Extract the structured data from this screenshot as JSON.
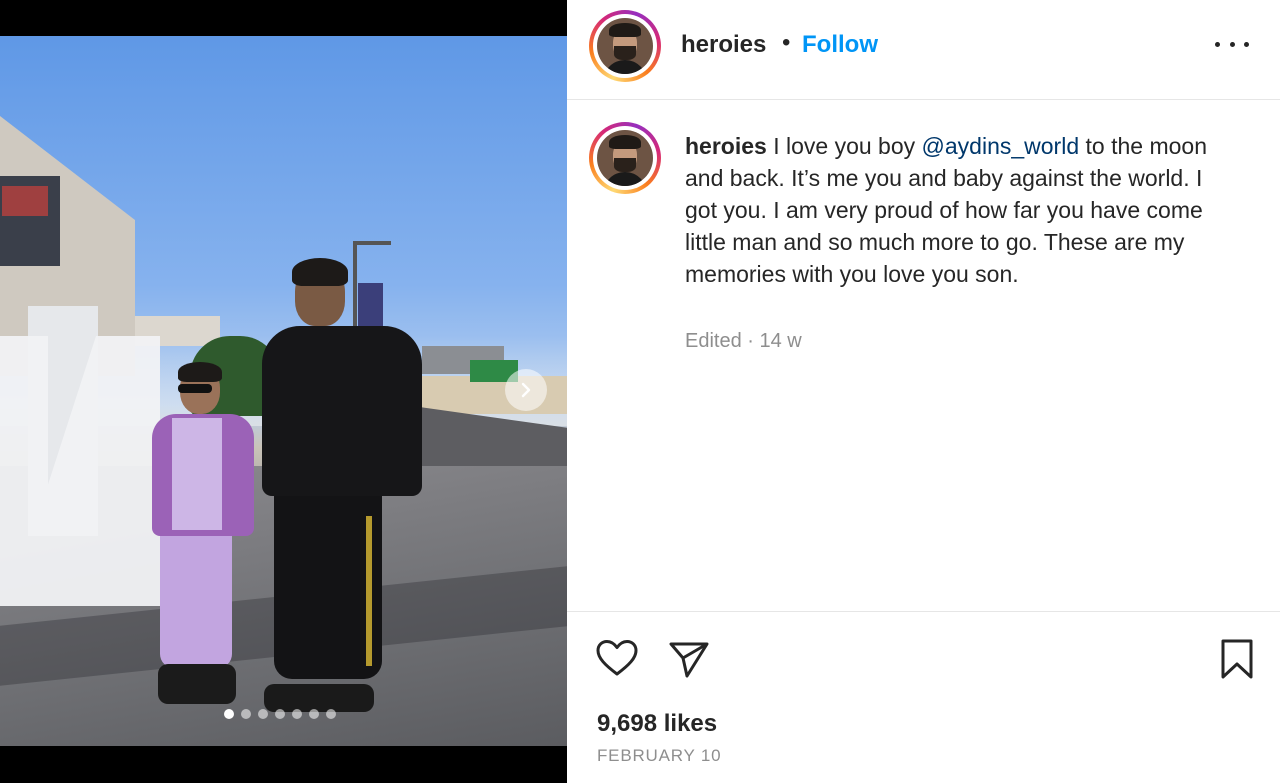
{
  "post": {
    "media": {
      "slides_total": 7,
      "active_slide": 1,
      "next_icon": "chevron-right-icon"
    },
    "header": {
      "username": "heroies",
      "separator": "•",
      "follow_label": "Follow",
      "more_icon": "more-horizontal-icon"
    },
    "caption": {
      "username": "heroies",
      "text_before": " I love you boy ",
      "mention": "@aydins_world",
      "text_after": " to the moon and back. It’s me you and baby against the world. I got you. I am very proud of how far you have come little man and so much more to go. These are my memories with you love you son.",
      "edited_label": "Edited",
      "meta_separator": " · ",
      "age": "14 w"
    },
    "actions": {
      "like_icon": "heart-outline-icon",
      "share_icon": "paper-plane-icon",
      "save_icon": "bookmark-outline-icon"
    },
    "likes_label": "9,698 likes",
    "date_label": "FEBRUARY 10",
    "colors": {
      "follow_blue": "#0095f6",
      "mention_blue": "#00376b",
      "meta_gray": "#8e8e8e",
      "text": "#262626"
    }
  }
}
